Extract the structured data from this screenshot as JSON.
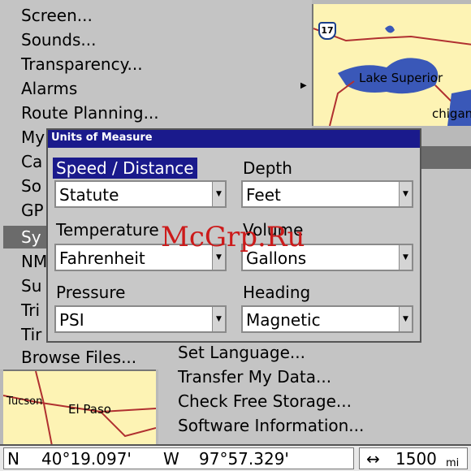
{
  "main_menu": {
    "items": [
      {
        "label": "Screen..."
      },
      {
        "label": "Sounds..."
      },
      {
        "label": "Transparency..."
      },
      {
        "label": "Alarms"
      },
      {
        "label": "Route Planning..."
      },
      {
        "label": "My"
      },
      {
        "label": "Ca"
      },
      {
        "label": "So"
      },
      {
        "label": "GP"
      },
      {
        "label": "Sy"
      },
      {
        "label": "NM"
      },
      {
        "label": "Su"
      },
      {
        "label": "Tri"
      },
      {
        "label": "Tir"
      },
      {
        "label": "Browse Files..."
      }
    ],
    "selected_index": 9
  },
  "system_submenu": {
    "items": [
      {
        "label": "Set Language..."
      },
      {
        "label": "Transfer My Data..."
      },
      {
        "label": "Check Free Storage..."
      },
      {
        "label": "Software Information..."
      }
    ]
  },
  "map": {
    "labels": {
      "lake_superior": "Lake Superior",
      "michigan": "chigan",
      "tucson": "Tucson",
      "el_paso": "El Paso"
    },
    "highway_shield": "17"
  },
  "dialog": {
    "title": "Units of Measure",
    "fields": {
      "speed_distance": {
        "label": "Speed / Distance",
        "value": "Statute"
      },
      "depth": {
        "label": "Depth",
        "value": "Feet"
      },
      "temperature": {
        "label": "Temperature",
        "value": "Fahrenheit"
      },
      "volume": {
        "label": "Volume",
        "value": "Gallons"
      },
      "pressure": {
        "label": "Pressure",
        "value": "PSI"
      },
      "heading": {
        "label": "Heading",
        "value": "Magnetic"
      }
    },
    "active_field": "speed_distance"
  },
  "watermark": "McGrp.Ru",
  "status_bar": {
    "lat_hemisphere": "N",
    "latitude": "40°19.097'",
    "lon_hemisphere": "W",
    "longitude": "97°57.329'",
    "scale_icon": "↔",
    "scale_value": "1500",
    "scale_unit": "mi"
  },
  "colors": {
    "dialog_title_bg": "#1a1a8c",
    "selected_menu_bg": "#6b6b6b",
    "map_land": "#fdf3b4",
    "map_water": "#3a58b8",
    "map_roads": "#b03030",
    "watermark": "#cc1a1a"
  }
}
